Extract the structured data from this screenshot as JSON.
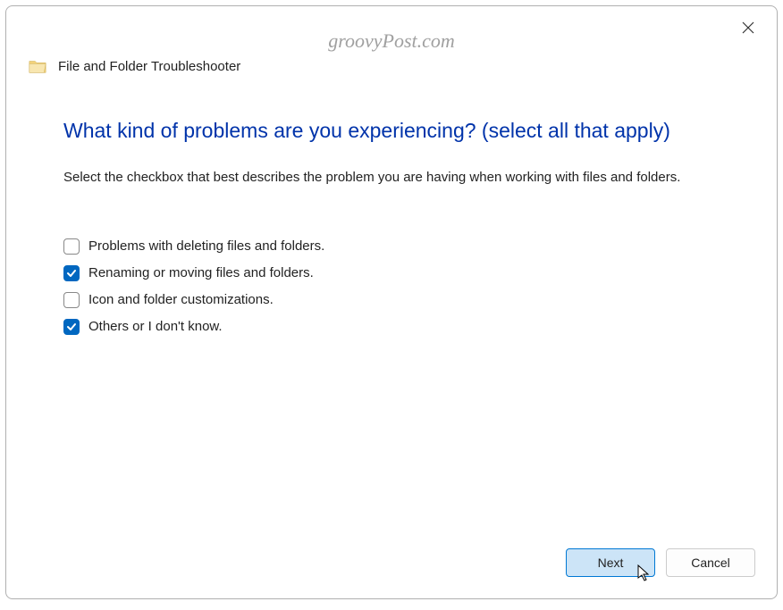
{
  "watermark": "groovyPost.com",
  "header": {
    "title": "File and Folder Troubleshooter"
  },
  "main": {
    "heading": "What kind of problems are you experiencing? (select all that apply)",
    "description": "Select the checkbox that best describes the problem you are having when working with files and folders."
  },
  "options": [
    {
      "label": "Problems with deleting files and folders.",
      "checked": false
    },
    {
      "label": "Renaming or moving files and folders.",
      "checked": true
    },
    {
      "label": "Icon and folder customizations.",
      "checked": false
    },
    {
      "label": "Others or I don't know.",
      "checked": true
    }
  ],
  "buttons": {
    "next": "Next",
    "cancel": "Cancel"
  }
}
